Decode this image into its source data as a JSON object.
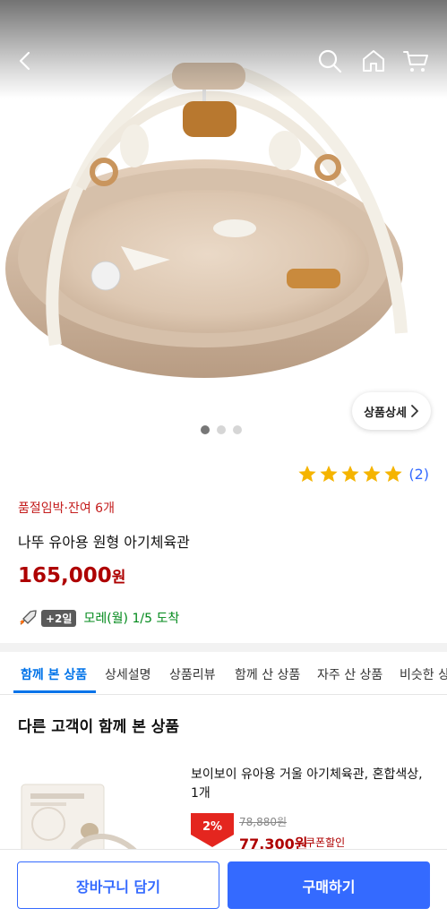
{
  "header": {
    "icons": [
      "back-arrow-icon",
      "search-icon",
      "home-icon",
      "cart-icon"
    ]
  },
  "gallery": {
    "detail_chip_label": "상품상세",
    "current_index": 1,
    "total": 3
  },
  "product": {
    "rating_stars": 5,
    "review_count": "(2)",
    "stock_notice": "품절임박·잔여 6개",
    "title": "나뚜 유아용 원형 아기체육관",
    "price": "165,000",
    "price_unit": "원",
    "delivery_badge": "+2일",
    "delivery_text": "모레(월) 1/5  도착"
  },
  "tabs": [
    {
      "label": "함께 본 상품",
      "active": true
    },
    {
      "label": "상세설명",
      "active": false
    },
    {
      "label": "상품리뷰",
      "active": false
    },
    {
      "label": "함께 산 상품",
      "active": false
    },
    {
      "label": "자주 산 상품",
      "active": false
    },
    {
      "label": "비슷한 상",
      "active": false
    }
  ],
  "related": {
    "section_title": "다른 고객이 함께 본 상품",
    "item": {
      "name": "보이보이 유아용 거울 아기체육관, 혼합색상, 1개",
      "discount": "2%",
      "original_price": "78,880원",
      "sale_price": "77,300원",
      "coupon_label": "쿠폰할인"
    }
  },
  "actions": {
    "add_to_cart": "장바구니 담기",
    "buy_now": "구매하기"
  },
  "colors": {
    "accent": "#346aff",
    "price_red": "#ae0000",
    "delivery_green": "#00891a",
    "star_yellow": "#f5b400"
  }
}
